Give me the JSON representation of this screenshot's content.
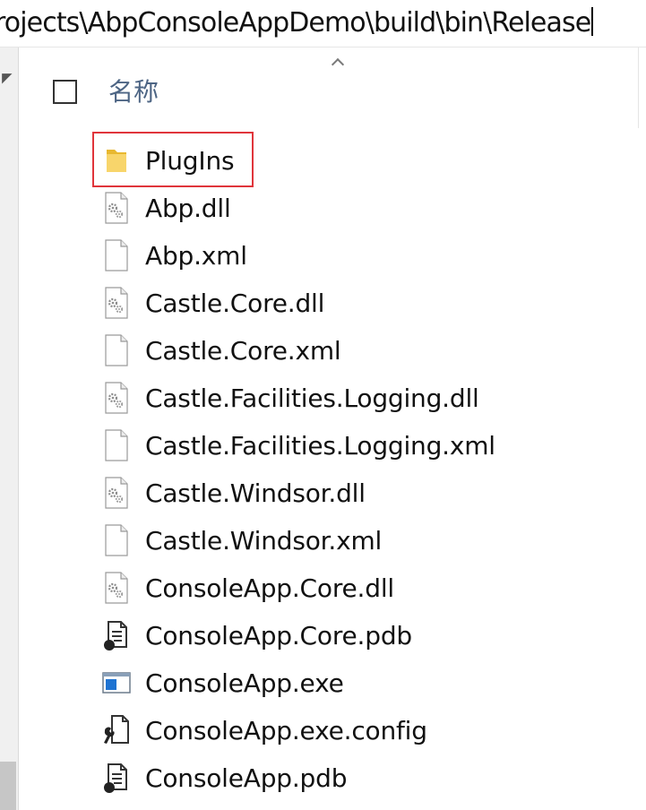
{
  "address": {
    "path": "rojects\\AbpConsoleAppDemo\\build\\bin\\Release"
  },
  "header": {
    "name_column": "名称"
  },
  "files": [
    {
      "name": "PlugIns",
      "icon": "folder-icon",
      "highlighted": true
    },
    {
      "name": "Abp.dll",
      "icon": "dll-icon"
    },
    {
      "name": "Abp.xml",
      "icon": "document-icon"
    },
    {
      "name": "Castle.Core.dll",
      "icon": "dll-icon"
    },
    {
      "name": "Castle.Core.xml",
      "icon": "document-icon"
    },
    {
      "name": "Castle.Facilities.Logging.dll",
      "icon": "dll-icon"
    },
    {
      "name": "Castle.Facilities.Logging.xml",
      "icon": "document-icon"
    },
    {
      "name": "Castle.Windsor.dll",
      "icon": "dll-icon"
    },
    {
      "name": "Castle.Windsor.xml",
      "icon": "document-icon"
    },
    {
      "name": "ConsoleApp.Core.dll",
      "icon": "dll-icon"
    },
    {
      "name": "ConsoleApp.Core.pdb",
      "icon": "pdb-icon"
    },
    {
      "name": "ConsoleApp.exe",
      "icon": "exe-icon"
    },
    {
      "name": "ConsoleApp.exe.config",
      "icon": "config-icon"
    },
    {
      "name": "ConsoleApp.pdb",
      "icon": "pdb-icon"
    }
  ],
  "colors": {
    "highlight_border": "#e0353b",
    "header_text": "#4d6584",
    "folder": "#f5c842"
  }
}
